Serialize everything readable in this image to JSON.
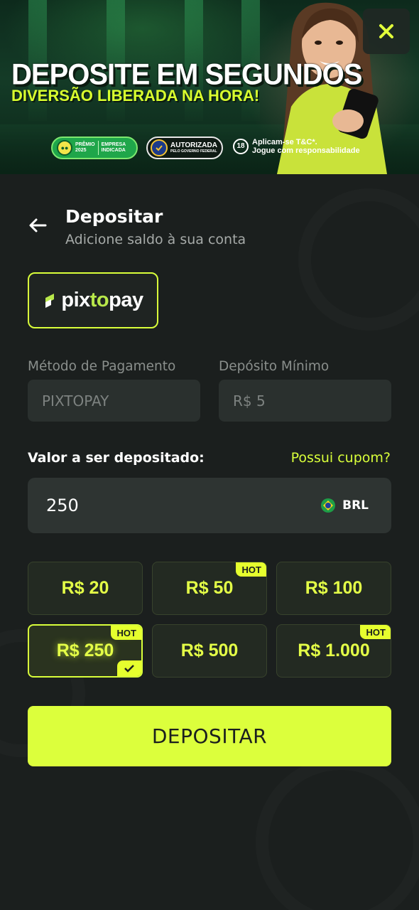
{
  "banner": {
    "title": "DEPOSITE EM SEGUNDOS",
    "subtitle": "DIVERSÃO LIBERADA NA HORA!",
    "badge_premio_line1": "PRÊMIO",
    "badge_premio_line2": "2025",
    "badge_premio_right1": "EMPRESA",
    "badge_premio_right2": "INDICADA",
    "badge_auth_big": "AUTORIZADA",
    "badge_auth_small": "PELO GOVERNO FEDERAL",
    "age_label": "18",
    "responsible_line1": "Aplicam-se T&C*.",
    "responsible_line2": "Jogue com responsabilidade",
    "close_icon": "close-icon"
  },
  "header": {
    "back_icon": "arrow-left-icon",
    "title": "Depositar",
    "subtitle": "Adicione saldo à sua conta"
  },
  "payment_method": {
    "logo_part1": "pix",
    "logo_part2": "to",
    "logo_part3": "pay"
  },
  "fields": {
    "method_label": "Método de Pagamento",
    "method_value": "PIXTOPAY",
    "min_label": "Depósito Mínimo",
    "min_value": "R$ 5"
  },
  "amount": {
    "label": "Valor a ser depositado:",
    "coupon_link": "Possui cupom?",
    "value": "250",
    "currency": "BRL",
    "currency_icon": "brazil-flag-icon"
  },
  "chips": [
    {
      "label": "R$ 20",
      "hot": false,
      "selected": false
    },
    {
      "label": "R$ 50",
      "hot": true,
      "selected": false
    },
    {
      "label": "R$ 100",
      "hot": false,
      "selected": false
    },
    {
      "label": "R$ 250",
      "hot": true,
      "selected": true
    },
    {
      "label": "R$ 500",
      "hot": false,
      "selected": false
    },
    {
      "label": "R$ 1.000",
      "hot": true,
      "selected": false
    }
  ],
  "hot_label": "HOT",
  "deposit_button": "DEPOSITAR",
  "colors": {
    "accent": "#dcff3c",
    "background": "#1b1f1e",
    "field": "#2a302e"
  }
}
